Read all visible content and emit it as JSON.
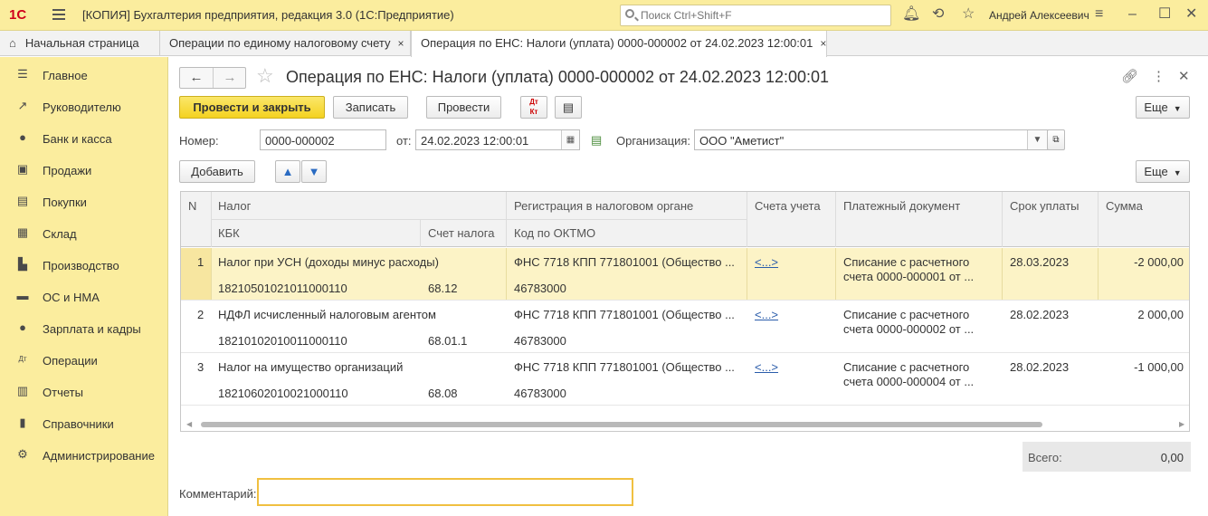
{
  "app": {
    "logo": "1С",
    "title": "[КОПИЯ] Бухгалтерия предприятия, редакция 3.0  (1С:Предприятие)",
    "search_placeholder": "Поиск Ctrl+Shift+F",
    "user": "Андрей Алексеевич"
  },
  "tabs": [
    {
      "label": "Начальная страница"
    },
    {
      "label": "Операции по единому налоговому счету",
      "close": "×"
    },
    {
      "label": "Операция по ЕНС: Налоги (уплата) 0000-000002 от 24.02.2023 12:00:01",
      "close": "×"
    }
  ],
  "sidebar": {
    "items": [
      {
        "label": "Главное",
        "icon": "menu-list-icon"
      },
      {
        "label": "Руководителю",
        "icon": "trend-icon"
      },
      {
        "label": "Банк и касса",
        "icon": "coin-icon"
      },
      {
        "label": "Продажи",
        "icon": "bag-icon"
      },
      {
        "label": "Покупки",
        "icon": "cart-icon"
      },
      {
        "label": "Склад",
        "icon": "warehouse-icon"
      },
      {
        "label": "Производство",
        "icon": "factory-icon"
      },
      {
        "label": "ОС и НМА",
        "icon": "truck-icon"
      },
      {
        "label": "Зарплата и кадры",
        "icon": "person-icon"
      },
      {
        "label": "Операции",
        "icon": "dt-kt-icon"
      },
      {
        "label": "Отчеты",
        "icon": "bar-chart-icon"
      },
      {
        "label": "Справочники",
        "icon": "book-icon"
      },
      {
        "label": "Администрирование",
        "icon": "gear-icon"
      }
    ]
  },
  "form": {
    "title": "Операция по ЕНС: Налоги (уплата) 0000-000002 от 24.02.2023 12:00:01",
    "toolbar": {
      "post_close": "Провести и закрыть",
      "save": "Записать",
      "post": "Провести",
      "more": "Еще"
    },
    "number_label": "Номер:",
    "number": "0000-000002",
    "date_label": "от:",
    "date": "24.02.2023 12:00:01",
    "org_label": "Организация:",
    "org": "ООО \"Аметист\"",
    "table_toolbar": {
      "add": "Добавить",
      "more": "Еще"
    },
    "columns": {
      "n": "N",
      "tax": "Налог",
      "kbk": "КБК",
      "tax_account": "Счет налога",
      "registration": "Регистрация в налоговом органе",
      "oktmo": "Код по ОКТМО",
      "accounts": "Счета учета",
      "payment_doc": "Платежный документ",
      "due_date": "Срок уплаты",
      "amount": "Сумма"
    },
    "rows": [
      {
        "n": "1",
        "tax": "Налог при УСН (доходы минус расходы)",
        "kbk": "18210501021011000110",
        "tax_account": "68.12",
        "registration": "ФНС 7718 КПП 771801001 (Общество ...",
        "oktmo": "46783000",
        "accounts": "<...>",
        "payment_doc": "Списание с расчетного счета 0000-000001 от ...",
        "due_date": "28.03.2023",
        "amount": "-2 000,00"
      },
      {
        "n": "2",
        "tax": "НДФЛ исчисленный налоговым агентом",
        "kbk": "18210102010011000110",
        "tax_account": "68.01.1",
        "registration": "ФНС 7718 КПП 771801001 (Общество ...",
        "oktmo": "46783000",
        "accounts": "<...>",
        "payment_doc": "Списание с расчетного счета 0000-000002 от ...",
        "due_date": "28.02.2023",
        "amount": "2 000,00"
      },
      {
        "n": "3",
        "tax": "Налог на имущество организаций",
        "kbk": "18210602010021000110",
        "tax_account": "68.08",
        "registration": "ФНС 7718 КПП 771801001 (Общество ...",
        "oktmo": "46783000",
        "accounts": "<...>",
        "payment_doc": "Списание с расчетного счета 0000-000004 от ...",
        "due_date": "28.02.2023",
        "amount": "-1 000,00"
      }
    ],
    "total_label": "Всего:",
    "total": "0,00",
    "comment_label": "Комментарий:",
    "comment": ""
  },
  "colors": {
    "accent_yellow": "#FBED9E",
    "primary_button": "#F4D220",
    "selected_row": "#FCF3C6",
    "link": "#2A5CAA"
  }
}
